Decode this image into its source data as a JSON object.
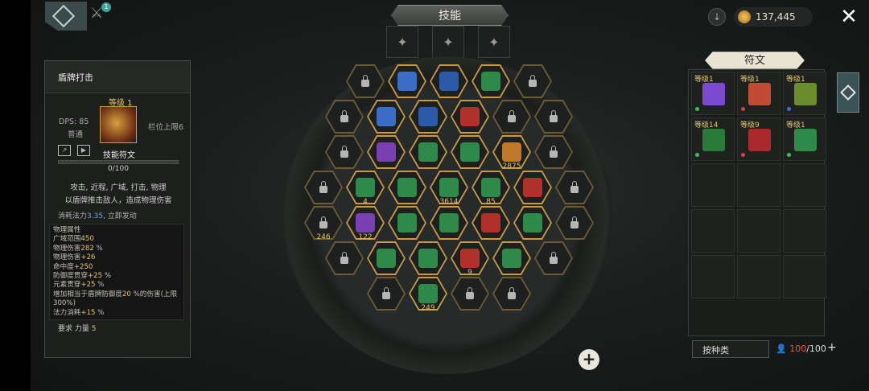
{
  "header": {
    "title": "技能",
    "notif_count": "1",
    "gold": "137,445"
  },
  "skill": {
    "name": "盾牌打击",
    "level": "等级 1",
    "dps": "DPS:  85",
    "rarity": "普通",
    "slot_limit": "栏位上限6",
    "rune_label": "技能符文",
    "xp": "0/100",
    "tags": "攻击, 近程, 广域, 打击, 物理",
    "desc": "以盾牌推击敌人，造成物理伤害",
    "cost_prefix": "消耗法力",
    "cost_value": "3.35",
    "cost_suffix": ", 立即发动",
    "stats_title": "物理属性",
    "stats": [
      {
        "label": "广域范围",
        "value": "450",
        "unit": ""
      },
      {
        "label": "物理伤害",
        "value": "282",
        "unit": " %"
      },
      {
        "label": "物理伤害",
        "value": "+26",
        "unit": ""
      },
      {
        "label": "命中度",
        "value": "+250",
        "unit": ""
      },
      {
        "label": "防御度贯穿",
        "value": "+25",
        "unit": " %"
      },
      {
        "label": "元素贯穿",
        "value": "+25",
        "unit": " %"
      },
      {
        "label": "增加相当于盾牌防御度",
        "value": "20",
        "unit": " %的伤害(上限 300%)"
      },
      {
        "label": "法力消耗",
        "value": "+15",
        "unit": " %"
      }
    ],
    "req_label": "要求 力量",
    "req_value": "5"
  },
  "board": {
    "numbers": [
      {
        "text": "2875",
        "cell": "r3c5"
      },
      {
        "text": "4",
        "cell": "r4c2"
      },
      {
        "text": "3614",
        "cell": "r4c4"
      },
      {
        "text": "85",
        "cell": "r4c5"
      },
      {
        "text": "246",
        "cell": "r5c1"
      },
      {
        "text": "122",
        "cell": "r5c2"
      },
      {
        "text": "9",
        "cell": "r6c4"
      },
      {
        "text": "249",
        "cell": "r7c2"
      }
    ]
  },
  "runes": {
    "tab": "符文",
    "items": [
      {
        "level": "等级1",
        "color": "#7a4ad0",
        "dot": "#38c060"
      },
      {
        "level": "等级1",
        "color": "#c04a34",
        "dot": "#d84040"
      },
      {
        "level": "等级1",
        "color": "#6a8c2a",
        "dot": "#3a70d8"
      },
      {
        "level": "等级14",
        "color": "#2a7a3a",
        "dot": "#38c060"
      },
      {
        "level": "等级9",
        "color": "#a82a2a",
        "dot": "#d84040"
      },
      {
        "level": "等级1",
        "color": "#2f8a4a",
        "dot": "#38c060"
      }
    ],
    "sort_label": "按种类",
    "cap_used": "100",
    "cap_total": "/100"
  }
}
